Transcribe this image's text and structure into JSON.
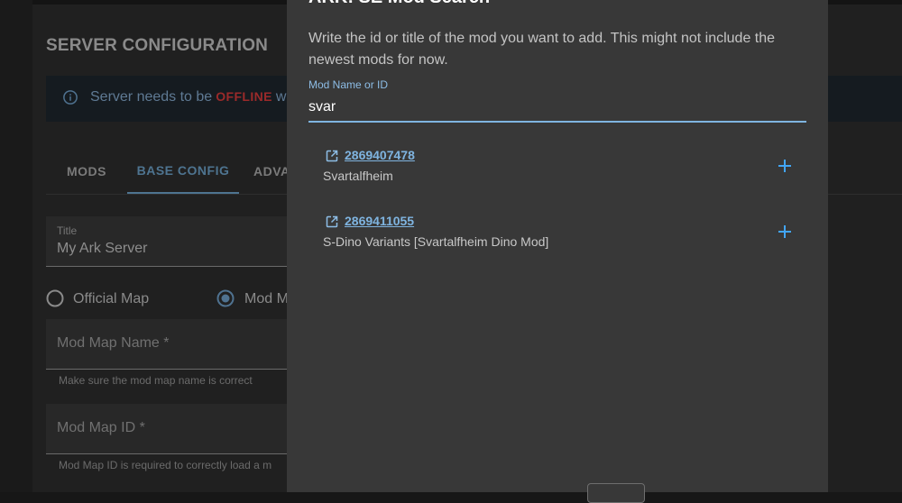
{
  "server_config": {
    "title": "SERVER CONFIGURATION",
    "alert": {
      "icon": "info-icon",
      "text": "Server needs to be",
      "status": "OFFLINE",
      "rest": "w"
    },
    "tabs": [
      {
        "label": "MODS"
      },
      {
        "label": "BASE CONFIG"
      },
      {
        "label": "ADVA"
      }
    ],
    "title_field": {
      "label": "Title",
      "value": "My Ark Server"
    },
    "map_radios": {
      "official_label": "Official Map",
      "mod_label": "Mod M"
    },
    "mod_map_name": {
      "placeholder": "Mod Map Name *",
      "hint": "Make sure the mod map name is correct"
    },
    "mod_map_id": {
      "placeholder": "Mod Map ID *",
      "hint": "Mod Map ID is required to correctly load a m"
    }
  },
  "dialog": {
    "title": "ARK: SE Mod Search",
    "description": "Write the id or title of the mod you want to add. This might not include the newest mods for now.",
    "search": {
      "label": "Mod Name or ID",
      "value": "svar"
    },
    "results": [
      {
        "id": "2869407478",
        "name": "Svartalfheim"
      },
      {
        "id": "2869411055",
        "name": "S-Dino Variants [Svartalfheim Dino Mod]"
      }
    ]
  },
  "colors": {
    "accent": "#7fb4e0",
    "offline": "#9b2a2a",
    "dialog_bg": "#383838",
    "page_bg": "#202020"
  }
}
